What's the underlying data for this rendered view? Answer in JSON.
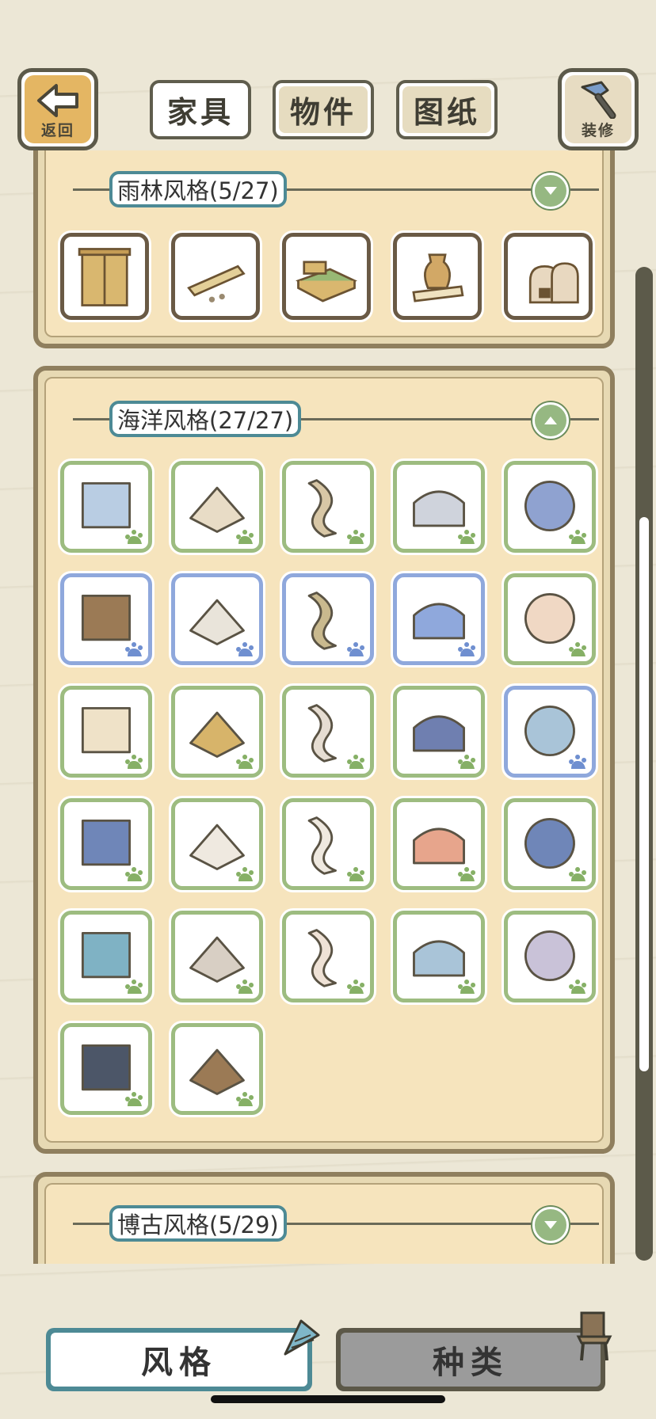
{
  "top_bar": {
    "back_label": "返回",
    "decor_label": "装修",
    "tabs": [
      "家具",
      "物件",
      "图纸"
    ],
    "active_tab": "家具"
  },
  "categories": [
    {
      "title": "雨林风格(5/27)",
      "expanded": false,
      "items": [
        "wardrobe-icon",
        "scroll-icon",
        "bed-icon",
        "vase-icon",
        "oven-icon"
      ]
    },
    {
      "title": "海洋风格(27/27)",
      "expanded": true,
      "items": [
        "bathroom-icon",
        "pool-icon",
        "ladder-icon",
        "stones-arch-icon",
        "porthole-mirror-icon",
        "arched-door-icon",
        "map-sheet-icon",
        "rolled-scroll-icon",
        "seashell-bed-icon",
        "sand-jar-icon",
        "notes-board-icon",
        "low-table-icon",
        "shell-icon",
        "cabinet-icon",
        "fish-jar-icon",
        "treasure-chest-icon",
        "shell-lamp-icon",
        "shell-chair-icon",
        "rolled-towels-icon",
        "kitchen-table-icon",
        "wood-tub-icon",
        "surfboard-mirror-icon",
        "coral-icon",
        "folding-screen-icon",
        "candle-shell-icon",
        "anchor-cabinet-icon",
        "barrels-icon"
      ],
      "blue_items": [
        5,
        6,
        7,
        8,
        14
      ]
    },
    {
      "title": "博古风格(5/29)",
      "expanded": false,
      "items": []
    }
  ],
  "bottom": {
    "style_label": "风格",
    "type_label": "种类"
  },
  "colors": {
    "background": "#ece7d6",
    "panel": "#f6e4bd",
    "green_border": "#9dbc80",
    "blue_border": "#8fa8dc",
    "title_border": "#4d8a95"
  }
}
